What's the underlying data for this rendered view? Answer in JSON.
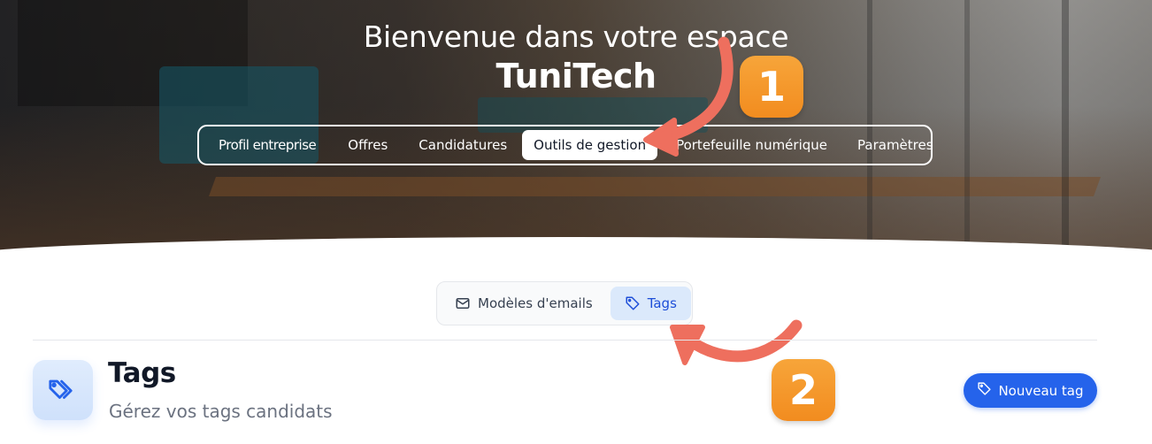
{
  "hero": {
    "welcome": "Bienvenue dans votre espace",
    "company": "TuniTech"
  },
  "main_nav": {
    "items": [
      {
        "label": "Profil entreprise"
      },
      {
        "label": "Offres"
      },
      {
        "label": "Candidatures"
      },
      {
        "label": "Outils de gestion",
        "active": true
      },
      {
        "label": "Portefeuille numérique"
      },
      {
        "label": "Paramètres"
      }
    ]
  },
  "sub_tabs": {
    "items": [
      {
        "label": "Modèles d'emails",
        "icon": "mail-icon"
      },
      {
        "label": "Tags",
        "icon": "tag-icon",
        "active": true
      }
    ]
  },
  "section": {
    "icon": "tags-icon",
    "title": "Tags",
    "subtitle": "Gérez vos tags candidats",
    "new_button_label": "Nouveau tag",
    "new_button_icon": "tag-icon"
  },
  "annotations": {
    "badge_1": "1",
    "badge_2": "2",
    "color": "#f28c1f",
    "arrow_color": "#ee6f5e"
  },
  "colors": {
    "accent": "#2563eb",
    "active_subtab_bg": "#dbe9fb"
  }
}
